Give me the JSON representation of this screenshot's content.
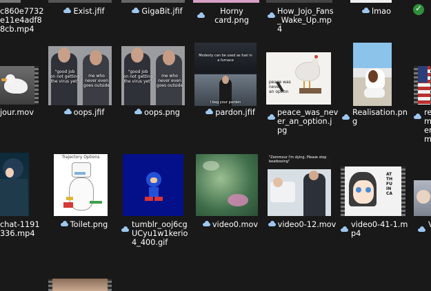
{
  "files": {
    "row0": [
      {
        "name": "c860e7732\ne11e4adf8\n8cb.mp4"
      },
      {
        "name": "Exist.jfif"
      },
      {
        "name": "GigaBit.jfif"
      },
      {
        "name": "Horny\ncard.png"
      },
      {
        "name": "How_Jojo_Fans\n_Wake_Up.mp\n4"
      },
      {
        "name": "lmao"
      }
    ],
    "row1": [
      {
        "name": "jour.mov"
      },
      {
        "name": "oops.jfif"
      },
      {
        "name": "oops.png"
      },
      {
        "name": "pardon.jfif"
      },
      {
        "name": "peace_was_nev\ner_an_option.j\npg"
      },
      {
        "name": "Realisation.pn\ng"
      },
      {
        "name": "re\nm\ner\nm"
      }
    ],
    "row2": [
      {
        "name": "chat-1191\n336.mp4"
      },
      {
        "name": "Toilet.png"
      },
      {
        "name": "tumblr_ooj6cg\nUCyu1w1kerio\n4_400.gif"
      },
      {
        "name": "video0.mov"
      },
      {
        "name": "video0-12.mov"
      },
      {
        "name": "video0-41-1.m\np4"
      },
      {
        "name": "V"
      }
    ]
  },
  "thumb_text": {
    "oops_left": "\"good job\non not getting\nthe virus yet\"",
    "oops_right": "me who\nnever even\ngoes outside",
    "pardon_top": "Modesty can be used as fuel in a furnace",
    "pardon_bottom": "I beg your pardon",
    "peace": "peace was\nnever\nan option",
    "toilet_title": "Trajectory Options",
    "hospital": "\"Zemmour I'm dying. Please stop\nbeatboxing\"",
    "manga": "AT\nTH\nFU\nIN\nCA"
  },
  "colors": {
    "background": "#191919",
    "cloud": "#9ec7ef",
    "sync_check": "#2f8f3a"
  }
}
